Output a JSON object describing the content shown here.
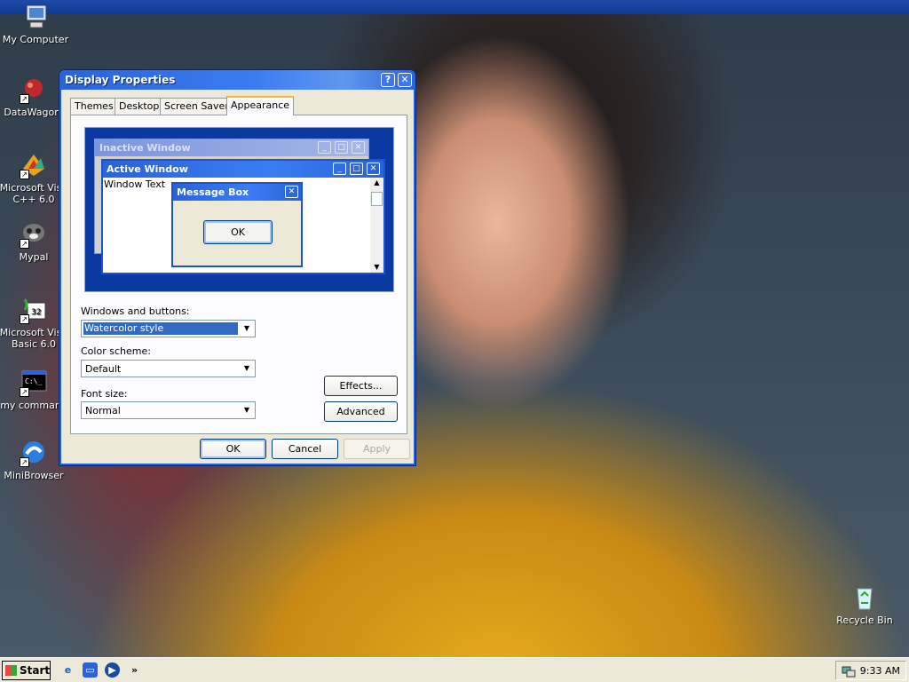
{
  "desktop": {
    "icons": [
      {
        "label": "My Computer",
        "icon": "my-computer-icon"
      },
      {
        "label": "DataWagon.",
        "icon": "datawagon-icon"
      },
      {
        "label": "Microsoft Visu",
        "label2": "C++ 6.0",
        "icon": "visual-cpp-icon"
      },
      {
        "label": "Mypal",
        "icon": "mypal-browser-icon"
      },
      {
        "label": "Microsoft Visu",
        "label2": "Basic 6.0",
        "icon": "visual-basic-icon"
      },
      {
        "label": "my command",
        "icon": "command-prompt-icon"
      },
      {
        "label": "MiniBrowser",
        "icon": "minibrowser-icon"
      },
      {
        "label": "Recycle Bin",
        "icon": "recycle-bin-icon"
      }
    ]
  },
  "window": {
    "title": "Display Properties",
    "help_btn": "?",
    "close_btn": "✕",
    "tabs": [
      "Themes",
      "Desktop",
      "Screen Saver",
      "Appearance"
    ],
    "active_tab": "Appearance",
    "preview": {
      "inactive_title": "Inactive Window",
      "active_title": "Active Window",
      "window_text": "Window Text",
      "message_title": "Message Box",
      "message_ok": "OK"
    },
    "fields": {
      "windows_buttons_label": "Windows and buttons:",
      "windows_buttons_value": "Watercolor style",
      "color_scheme_label": "Color scheme:",
      "color_scheme_value": "Default",
      "font_size_label": "Font size:",
      "font_size_value": "Normal"
    },
    "buttons": {
      "effects": "Effects...",
      "advanced": "Advanced",
      "ok": "OK",
      "cancel": "Cancel",
      "apply": "Apply"
    }
  },
  "taskbar": {
    "start_label": "Start",
    "chevron": "»",
    "clock": "9:33 AM"
  },
  "colors": {
    "titlebar": "#2a63d8",
    "selection": "#316ac5",
    "tab_highlight": "#f7b640"
  }
}
